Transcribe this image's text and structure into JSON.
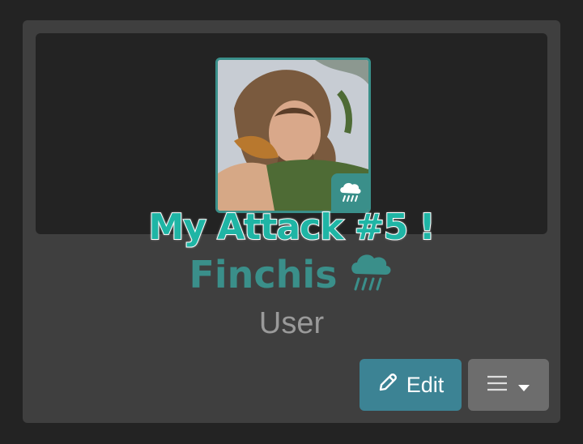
{
  "overlay": {
    "caption": "My Attack #5 !"
  },
  "profile": {
    "username": "Finchis",
    "rank": "User",
    "status_icon": "rain-cloud-icon",
    "avatar_badge_icon": "rain-cloud-icon"
  },
  "actions": {
    "edit_label": "Edit",
    "edit_icon": "pencil-icon",
    "menu_icon": "hamburger-menu-icon",
    "menu_caret": "caret-down-icon"
  },
  "colors": {
    "accent": "#3a8f8a",
    "edit_button": "#3c8394",
    "menu_button": "#6d6d6d",
    "card": "#3f3f3f",
    "background": "#232323"
  }
}
